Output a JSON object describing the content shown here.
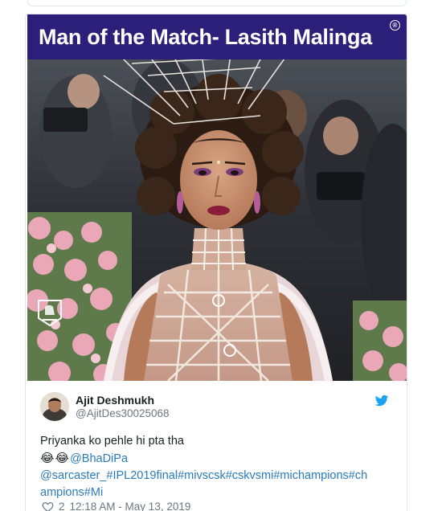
{
  "meme": {
    "banner_text": "Man of the Match- Lasith Malinga",
    "banner_color": "#2b1f7a",
    "registered_mark": "®"
  },
  "tweet": {
    "author_name": "Ajit Deshmukh",
    "author_handle": "@AjitDes30025068",
    "text_line1": "Priyanka ko pehle hi pta tha",
    "emojis": "😂😂",
    "mention": "@BhaDiPa",
    "hashtags_line1": "@sarcaster_#IPL2019final#mivscsk#cskvsmi#michampions#ch",
    "hashtags_line2": "ampions#Mi",
    "likes": "2",
    "timestamp": "12:18 AM - May 13, 2019",
    "icons": {
      "platform": "twitter-bird-icon",
      "like": "heart-icon"
    },
    "link_color": "#2b7bb9"
  }
}
